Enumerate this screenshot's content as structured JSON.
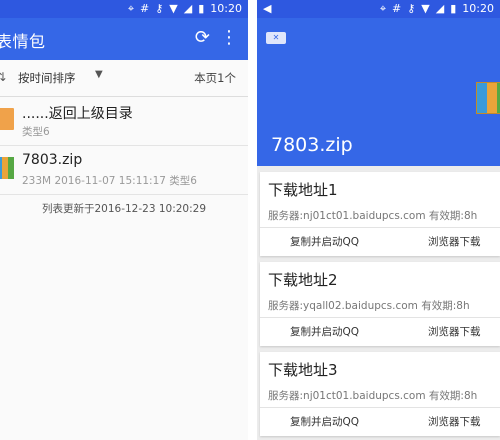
{
  "status": {
    "time": "10:20"
  },
  "left": {
    "title": "表情包",
    "sort": {
      "label": "按时间排序",
      "page_info": "本页1个"
    },
    "files": [
      {
        "name": "......返回上级目录",
        "meta": "类型6",
        "icon": "folder-icon"
      },
      {
        "name": "7803.zip",
        "meta": "233M  2016-11-07 15:11:17 类型6",
        "icon": "zip-icon"
      }
    ],
    "update_note": "列表更新于2016-12-23 10:20:29"
  },
  "right": {
    "file_title": "7803.zip",
    "cards": [
      {
        "title": "下载地址1",
        "server": "服务器:nj01ct01.baidupcs.com  有效期:8h",
        "copy_label": "复制并启动QQ",
        "browser_label": "浏览器下载"
      },
      {
        "title": "下载地址2",
        "server": "服务器:yqall02.baidupcs.com  有效期:8h",
        "copy_label": "复制并启动QQ",
        "browser_label": "浏览器下载"
      },
      {
        "title": "下载地址3",
        "server": "服务器:nj01ct01.baidupcs.com  有效期:8h",
        "copy_label": "复制并启动QQ",
        "browser_label": "浏览器下载"
      }
    ]
  },
  "colors": {
    "primary": "#3567e7",
    "status_bar": "#2e58e0"
  }
}
